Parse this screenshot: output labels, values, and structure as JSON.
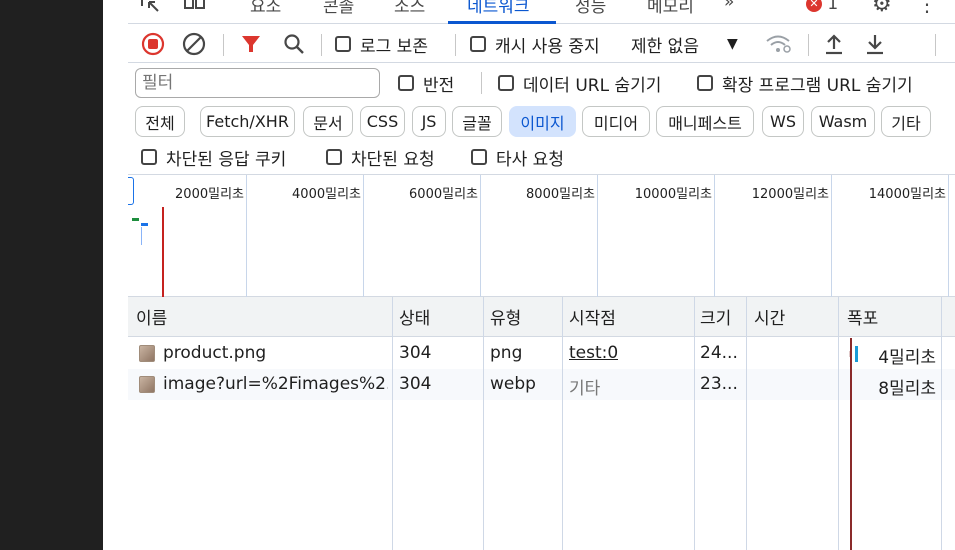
{
  "tabs": [
    {
      "label": "요소"
    },
    {
      "label": "콘솔"
    },
    {
      "label": "소스"
    },
    {
      "label": "네트워크"
    },
    {
      "label": "성능"
    },
    {
      "label": "메모리"
    }
  ],
  "tabs_more": "»",
  "error_count": "1",
  "toolbar": {
    "preserve_log": "로그 보존",
    "disable_cache": "캐시 사용 중지",
    "throttling": "제한 없음"
  },
  "filter": {
    "placeholder": "필터",
    "invert": "반전",
    "hide_data_urls": "데이터 URL 숨기기",
    "hide_extension_urls": "확장 프로그램 URL 숨기기"
  },
  "type_chips": [
    {
      "label": "전체",
      "selected": false
    },
    {
      "label": "Fetch/XHR",
      "selected": false
    },
    {
      "label": "문서",
      "selected": false
    },
    {
      "label": "CSS",
      "selected": false
    },
    {
      "label": "JS",
      "selected": false
    },
    {
      "label": "글꼴",
      "selected": false
    },
    {
      "label": "이미지",
      "selected": true
    },
    {
      "label": "미디어",
      "selected": false
    },
    {
      "label": "매니페스트",
      "selected": false
    },
    {
      "label": "WS",
      "selected": false
    },
    {
      "label": "Wasm",
      "selected": false
    },
    {
      "label": "기타",
      "selected": false
    }
  ],
  "extra_filters": {
    "blocked_cookies": "차단된 응답 쿠키",
    "blocked_requests": "차단된 요청",
    "third_party": "타사 요청"
  },
  "overview_ticks": [
    "2000밀리초",
    "4000밀리초",
    "6000밀리초",
    "8000밀리초",
    "10000밀리초",
    "12000밀리초",
    "14000밀리초"
  ],
  "columns": {
    "name": "이름",
    "status": "상태",
    "type": "유형",
    "initiator": "시작점",
    "size": "크기",
    "time": "시간",
    "waterfall": "폭포"
  },
  "requests": [
    {
      "name": "product.png",
      "status": "304",
      "type": "png",
      "initiator": "test:0",
      "size": "24...",
      "time": "4밀리초"
    },
    {
      "name": "image?url=%2Fimages%2...",
      "status": "304",
      "type": "webp",
      "initiator": "기타",
      "size": "23...",
      "time": "8밀리초"
    }
  ],
  "colors": {
    "accent": "#0b57d0",
    "record": "#dc362e",
    "chip_selected_bg": "#d3e3fd",
    "load_line": "#c5221f"
  }
}
